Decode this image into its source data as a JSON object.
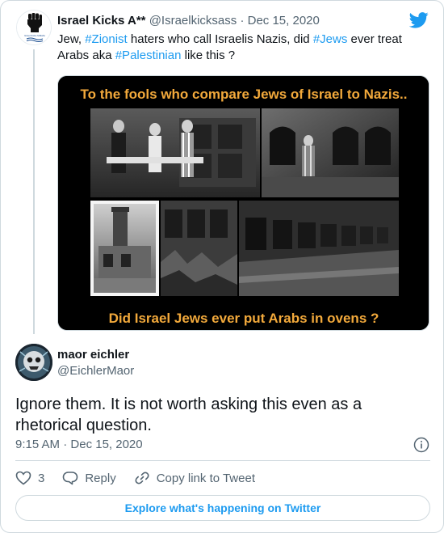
{
  "parent_tweet": {
    "display_name": "Israel Kicks A**",
    "handle": "@Israelkicksass",
    "separator": "·",
    "date": "Dec 15, 2020",
    "avatar_caption": "Israel Kicks Mdlabs",
    "text_segments": [
      {
        "text": "Jew, ",
        "type": "text"
      },
      {
        "text": "#Zionist",
        "type": "hashtag"
      },
      {
        "text": " haters who call Israelis Nazis, did ",
        "type": "text"
      },
      {
        "text": "#Jews",
        "type": "hashtag"
      },
      {
        "text": " ever treat Arabs aka ",
        "type": "text"
      },
      {
        "text": "#Palestinian",
        "type": "hashtag"
      },
      {
        "text": " like this ?",
        "type": "text"
      }
    ],
    "media": {
      "top_caption": "To the fools who compare Jews of Israel to Nazis..",
      "bottom_caption": "Did Israel Jews ever put Arabs in ovens ?"
    }
  },
  "reply_tweet": {
    "display_name": "maor eichler",
    "handle": "@EichlerMaor",
    "text": "Ignore them. It is not worth asking this even as a rhetorical question.",
    "time": "9:15 AM",
    "separator": "·",
    "date": "Dec 15, 2020"
  },
  "actions": {
    "like_count": "3",
    "reply_label": "Reply",
    "copy_link_label": "Copy link to Tweet"
  },
  "explore_label": "Explore what's happening on Twitter",
  "icons": {
    "brand": "twitter-bird-icon",
    "info": "info-icon",
    "like": "heart-icon",
    "reply": "speech-bubble-icon",
    "link": "link-icon"
  },
  "colors": {
    "accent": "#1d9bf0",
    "text": "#0f1419",
    "muted": "#536471",
    "border": "#cfd9de",
    "media_caption": "#f2a93b",
    "media_frame": "#000000"
  }
}
